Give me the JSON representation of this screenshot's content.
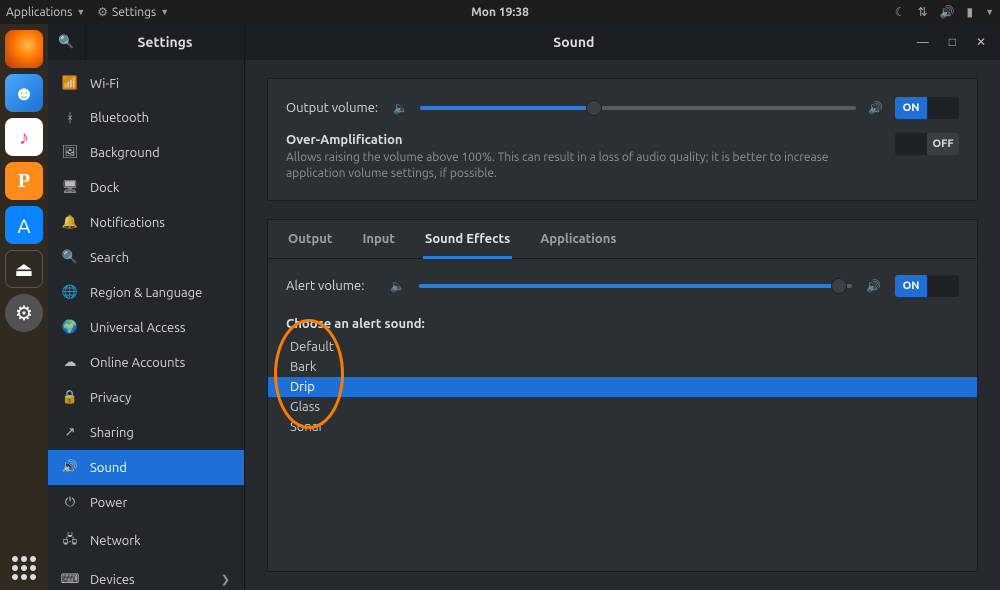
{
  "top_panel": {
    "applications": "Applications",
    "settings_menu": "Settings",
    "clock": "Mon 19:38"
  },
  "window": {
    "app_title": "Settings",
    "page_title": "Sound"
  },
  "sidebar": {
    "items": [
      {
        "icon": "wifi",
        "label": "Wi-Fi"
      },
      {
        "icon": "bluetooth",
        "label": "Bluetooth"
      },
      {
        "icon": "background",
        "label": "Background"
      },
      {
        "icon": "dock",
        "label": "Dock"
      },
      {
        "icon": "notifications",
        "label": "Notifications"
      },
      {
        "icon": "search",
        "label": "Search"
      },
      {
        "icon": "region",
        "label": "Region & Language"
      },
      {
        "icon": "universal",
        "label": "Universal Access"
      },
      {
        "icon": "online",
        "label": "Online Accounts"
      },
      {
        "icon": "privacy",
        "label": "Privacy"
      },
      {
        "icon": "sharing",
        "label": "Sharing"
      },
      {
        "icon": "sound",
        "label": "Sound",
        "active": true
      },
      {
        "icon": "power",
        "label": "Power"
      },
      {
        "icon": "network",
        "label": "Network"
      },
      {
        "icon": "devices",
        "label": "Devices",
        "chevron": true
      }
    ]
  },
  "output": {
    "label": "Output volume:",
    "value_pct": 40,
    "toggle_on": "ON",
    "toggle_off": ""
  },
  "overamp": {
    "title": "Over-Amplification",
    "desc": "Allows raising the volume above 100%. This can result in a loss of audio quality; it is better to increase application volume settings, if possible.",
    "toggle_on": "",
    "toggle_off": "OFF"
  },
  "tabs": [
    "Output",
    "Input",
    "Sound Effects",
    "Applications"
  ],
  "active_tab": 2,
  "alert": {
    "label": "Alert volume:",
    "value_pct": 97,
    "toggle_on": "ON",
    "toggle_off": ""
  },
  "choose_label": "Choose an alert sound:",
  "alert_sounds": [
    "Default",
    "Bark",
    "Drip",
    "Glass",
    "Sonar"
  ],
  "selected_sound": 2
}
